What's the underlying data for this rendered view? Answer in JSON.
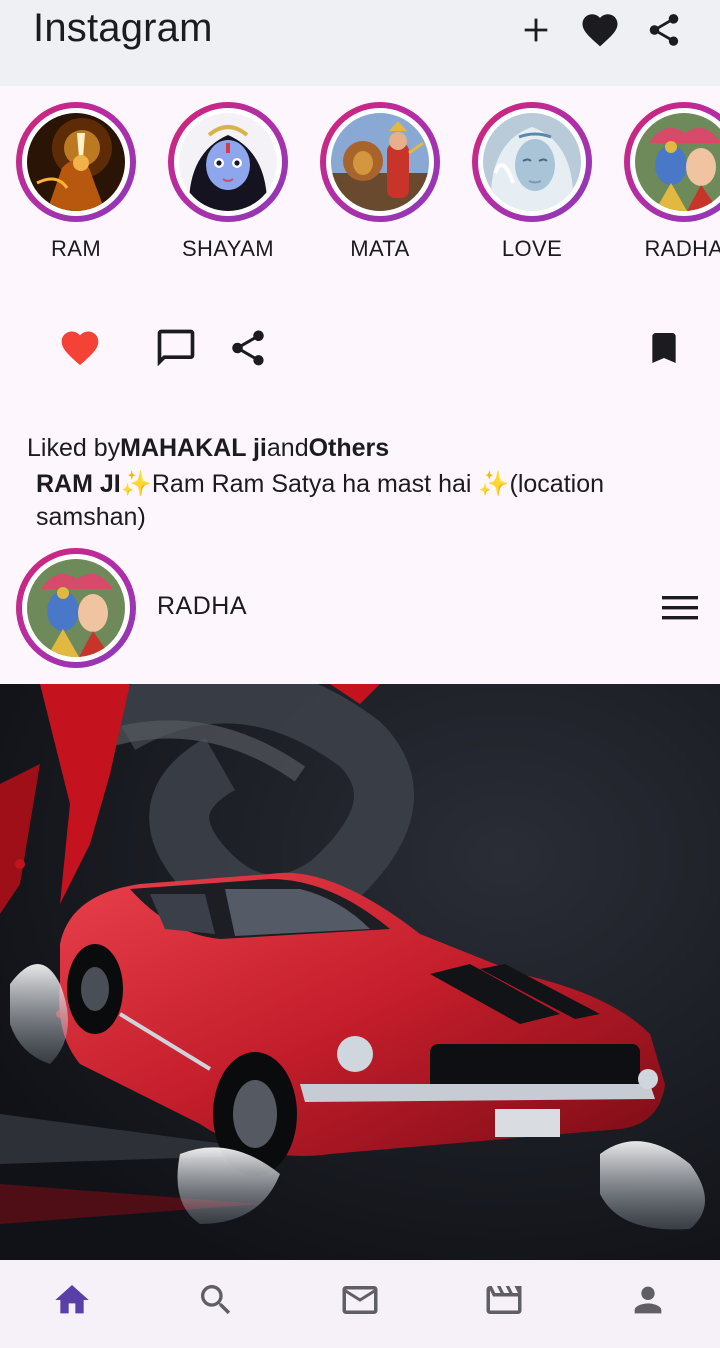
{
  "app": {
    "title": "Instagram"
  },
  "stories": [
    {
      "label": "RAM"
    },
    {
      "label": "SHAYAM"
    },
    {
      "label": "MATA"
    },
    {
      "label": "LOVE"
    },
    {
      "label": "RADHA"
    }
  ],
  "post": {
    "liked_prefix": "Liked by",
    "liked_user": "MAHAKAL ji",
    "liked_and": "and",
    "liked_others": "Others",
    "caption_user": "RAM JI",
    "caption_text": "✨Ram Ram Satya ha  mast hai ✨(location samshan)",
    "next_post_user": "RADHA"
  },
  "colors": {
    "accent": "#5b3fa8",
    "like_red": "#f44336",
    "ring_start": "#d6246e",
    "ring_end": "#8a3ab9",
    "appbar_bg": "#eef0f4",
    "page_bg": "#fdf7fd"
  },
  "icons": {
    "appbar": [
      "add-icon",
      "heart-icon",
      "share-icon"
    ],
    "post_actions": [
      "heart-filled-icon",
      "comment-icon",
      "share-icon",
      "bookmark-icon"
    ],
    "bottom_nav": [
      "home-icon",
      "search-icon",
      "mail-icon",
      "reels-icon",
      "profile-icon"
    ]
  }
}
